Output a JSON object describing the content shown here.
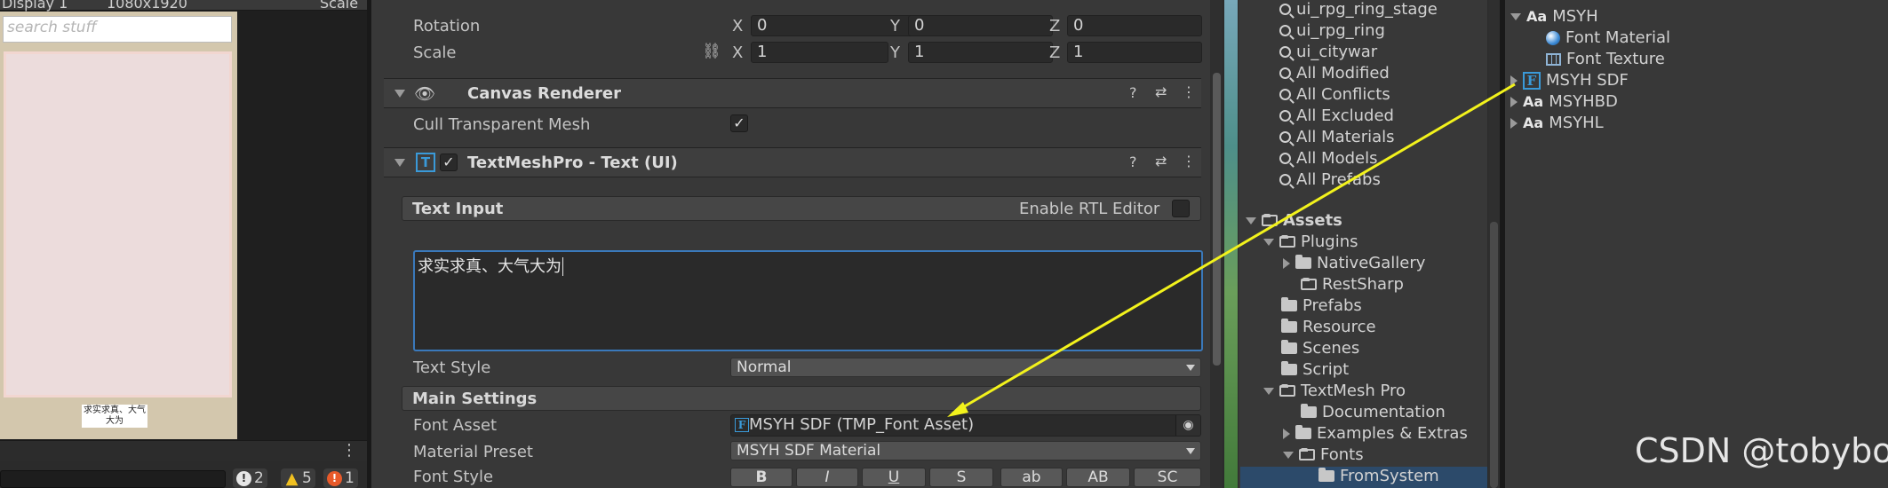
{
  "game_view": {
    "display_label": "Display 1",
    "resolution_label": "1080x1920",
    "scale_label": "Scale",
    "search_placeholder": "search stuff",
    "caption_line1": "求实求真、大气",
    "caption_line2": "大为",
    "console": {
      "info_count": "2",
      "warning_count": "5",
      "error_count": "1"
    }
  },
  "inspector": {
    "rotation": {
      "label": "Rotation",
      "x": "0",
      "y": "0",
      "z": "0"
    },
    "scale": {
      "label": "Scale",
      "x": "1",
      "y": "1",
      "z": "1"
    },
    "axis": {
      "x": "X",
      "y": "Y",
      "z": "Z"
    },
    "canvas_renderer": {
      "title": "Canvas Renderer",
      "cull_label": "Cull Transparent Mesh"
    },
    "tmp": {
      "title": "TextMeshPro - Text (UI)",
      "text_input_label": "Text Input",
      "rtl_label": "Enable RTL Editor",
      "text_value": "求实求真、大气大为",
      "text_style_label": "Text Style",
      "text_style_value": "Normal",
      "main_settings_label": "Main Settings",
      "font_asset_label": "Font Asset",
      "font_asset_value": "MSYH SDF (TMP_Font Asset)",
      "material_preset_label": "Material Preset",
      "material_preset_value": "MSYH SDF Material",
      "font_style_label": "Font Style",
      "font_style_buttons": [
        "B",
        "I",
        "U",
        "S",
        "ab",
        "AB",
        "SC"
      ]
    }
  },
  "project": {
    "search_items": [
      "ui_rpg_ring_stage",
      "ui_rpg_ring",
      "ui_citywar",
      "All Modified",
      "All Conflicts",
      "All Excluded",
      "All Materials",
      "All Models",
      "All Prefabs"
    ],
    "assets_label": "Assets",
    "plugins": "Plugins",
    "native_gallery": "NativeGallery",
    "rest_sharp": "RestSharp",
    "prefabs": "Prefabs",
    "resource": "Resource",
    "scenes": "Scenes",
    "script": "Script",
    "textmesh_pro": "TextMesh Pro",
    "documentation": "Documentation",
    "examples": "Examples & Extras",
    "fonts": "Fonts",
    "from_system": "FromSystem"
  },
  "assets_panel": {
    "msyh": "MSYH",
    "font_material": "Font Material",
    "font_texture": "Font Texture",
    "msyh_sdf": "MSYH SDF",
    "msyhbd": "MSYHBD",
    "msyhl": "MSYHL",
    "aa_glyph": "Aa",
    "f_glyph": "F"
  },
  "watermark": "CSDN @tobybo",
  "colors": {
    "selection_blue": "#3a79bb",
    "arrow_yellow": "#f2f21c",
    "warning_yellow": "#f0c020",
    "error_orange": "#e85a2a"
  }
}
